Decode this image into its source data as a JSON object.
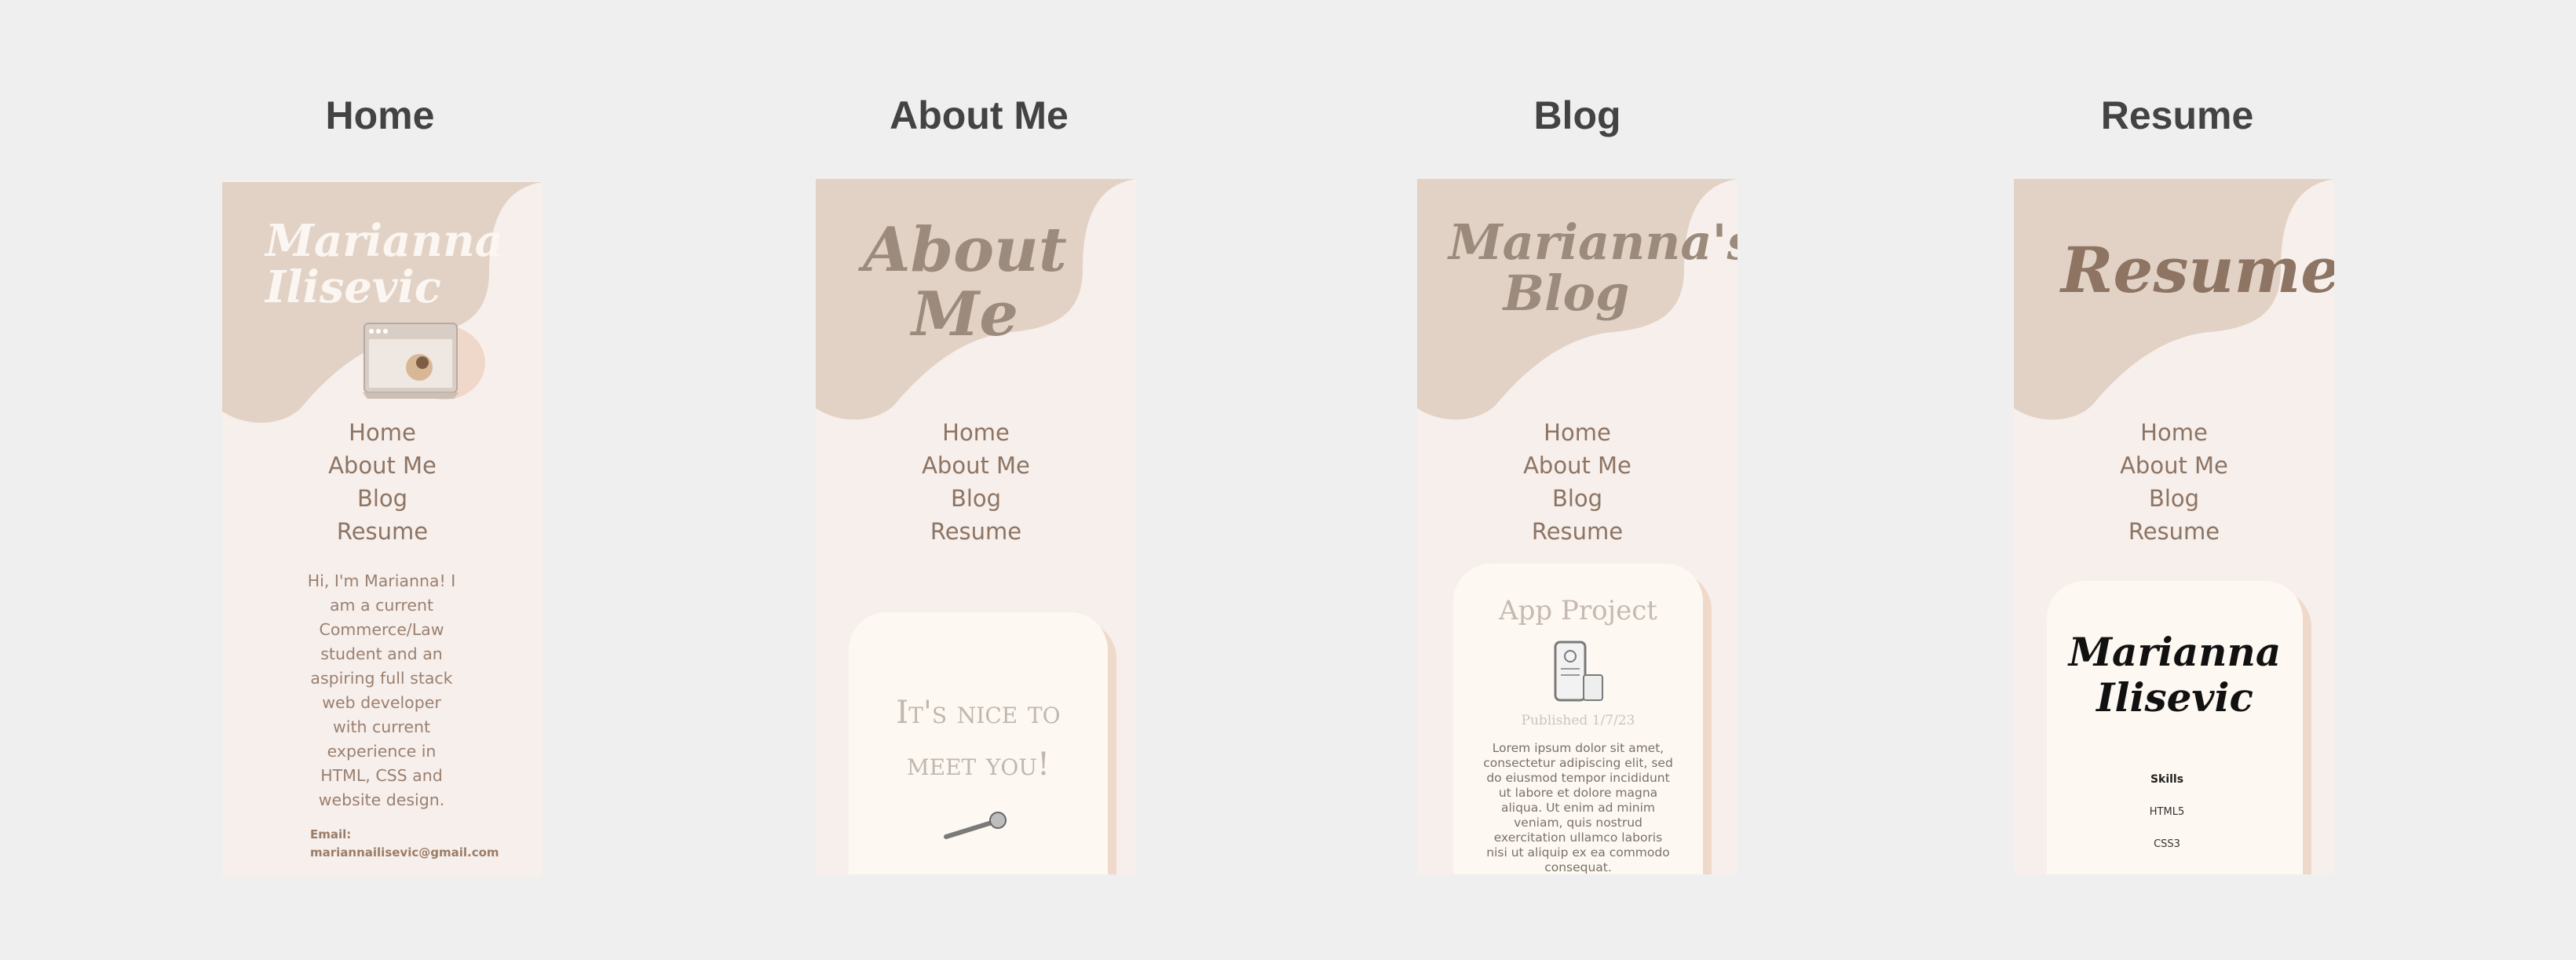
{
  "columns": {
    "home": "Home",
    "about": "About Me",
    "blog": "Blog",
    "resume": "Resume"
  },
  "nav": [
    "Home",
    "About Me",
    "Blog",
    "Resume"
  ],
  "home": {
    "name_line1": "Marianna",
    "name_line2": "Ilisevic",
    "bio": "Hi, I'm Marianna! I am a current Commerce/Law student and an aspiring full stack web developer with current experience in HTML, CSS and website design.",
    "email_label": "Email:",
    "email": "mariannailisevic@gmail.com"
  },
  "about": {
    "heading": "About Me",
    "greeting_line1": "It's nice to",
    "greeting_line2": "meet you!"
  },
  "blog": {
    "heading_line1": "Marianna's",
    "heading_line2": "Blog",
    "post_title": "App Project",
    "published": "Published 1/7/23",
    "excerpt": "Lorem ipsum dolor sit amet, consectetur adipiscing elit, sed do eiusmod tempor incididunt ut labore et dolore magna aliqua. Ut enim ad minim veniam, quis nostrud exercitation ullamco laboris nisi ut aliquip ex ea commodo consequat."
  },
  "resume": {
    "heading": "Resume",
    "name_line1": "Marianna",
    "name_line2": "Ilisevic",
    "skills_label": "Skills",
    "skills": [
      "HTML5",
      "CSS3"
    ]
  },
  "colors": {
    "background": "#efefef",
    "phone_bg": "#f7efeb",
    "blob": "#e2d2c5",
    "nav_text": "#8d7463",
    "card": "#fdf8f1",
    "card_shadow": "#efd9cb"
  }
}
